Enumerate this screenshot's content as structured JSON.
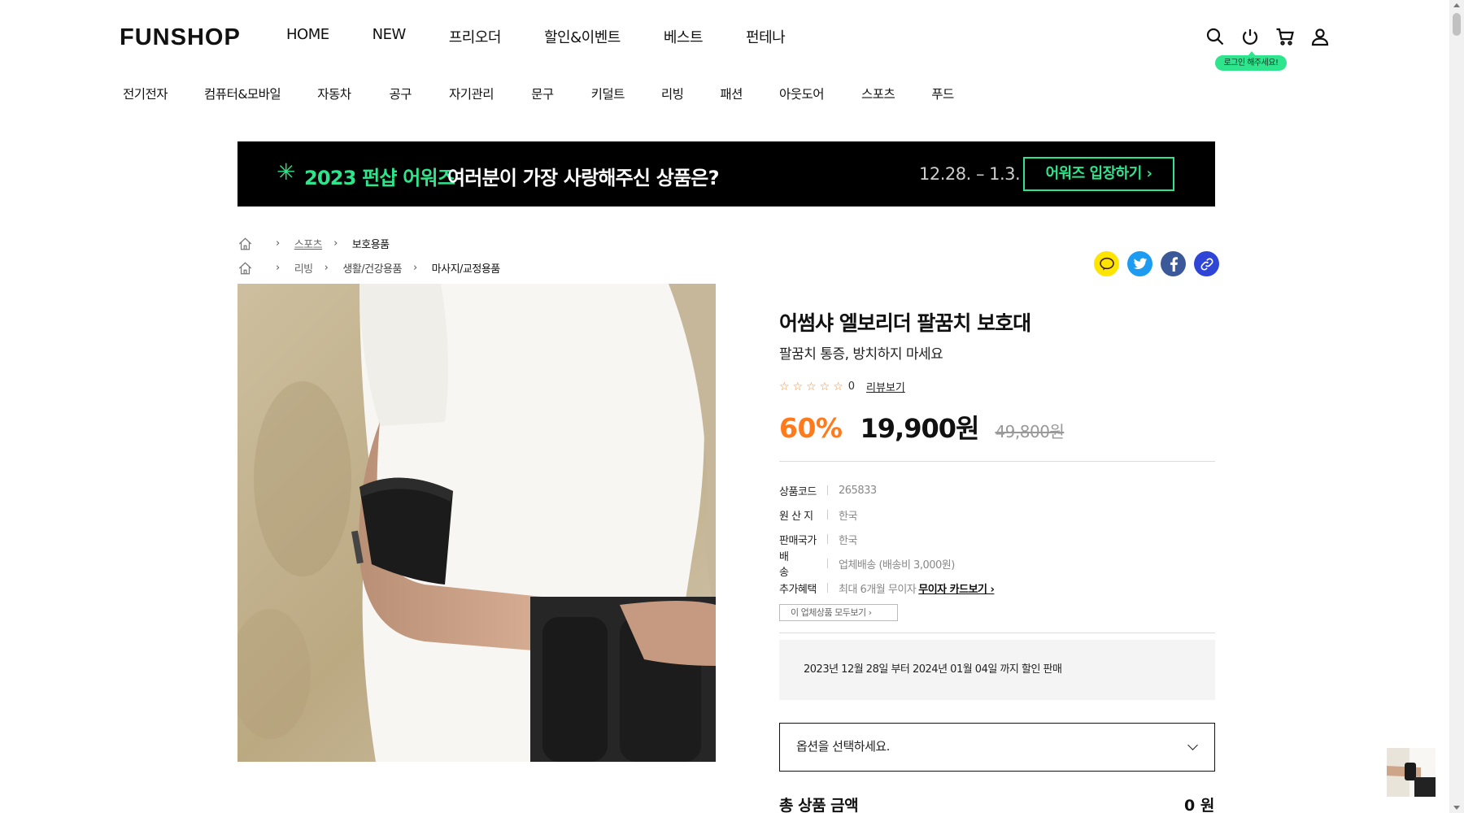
{
  "header": {
    "logo": "FUNSHOP",
    "nav": [
      "HOME",
      "NEW",
      "프리오더",
      "할인&이벤트",
      "베스트",
      "펀테나"
    ],
    "login_tooltip": "로그인 해주세요!",
    "icons": [
      "search-icon",
      "power-icon",
      "cart-icon",
      "user-icon"
    ]
  },
  "categories": [
    "전기전자",
    "컴퓨터&모바일",
    "자동차",
    "공구",
    "자기관리",
    "문구",
    "키덜트",
    "리빙",
    "패션",
    "아웃도어",
    "스포츠",
    "푸드"
  ],
  "banner": {
    "highlight": "2023 펀샵 어워즈",
    "text": "여러분이 가장 사랑해주신 상품은?",
    "date": "12.28. – 1.3.",
    "button": "어워즈 입장하기 ›"
  },
  "breadcrumbs": [
    [
      "스포츠",
      "보호용품"
    ],
    [
      "리빙",
      "생활/건강용품",
      "마사지/교정용품"
    ]
  ],
  "share_icons": [
    "kakao-icon",
    "twitter-icon",
    "facebook-icon",
    "link-icon"
  ],
  "product": {
    "title": "어썸샤 엘보리더 팔꿈치 보호대",
    "subtitle": "팔꿈치 통증, 방치하지 마세요",
    "stars": "☆☆☆☆☆",
    "review_count": "0",
    "review_link": "리뷰보기",
    "discount": "60%",
    "price": "19,900원",
    "original_price": "49,800원",
    "specs": [
      {
        "key": "상품코드",
        "value": "265833"
      },
      {
        "key": "원 산 지",
        "value": "한국"
      },
      {
        "key": "판매국가",
        "value": "한국"
      },
      {
        "key": "배　　송",
        "value": "업체배송 (배송비 3,000원)"
      },
      {
        "key": "추가혜택",
        "value": "최대 6개월 무이자",
        "link": "무이자 카드보기 ›"
      }
    ],
    "vendor_all_button": "이 업체상품 모두보기 ›",
    "sale_notice": "2023년 12월 28일 부터 2024년 01월 04일 까지 할인 판매",
    "option_placeholder": "옵션을 선택하세요.",
    "total_label": "총 상품 금액",
    "total_value": "0 원"
  },
  "colors": {
    "accent_green": "#2ee48c",
    "discount_orange": "#ff7a1a",
    "banner_bg": "#000000"
  }
}
